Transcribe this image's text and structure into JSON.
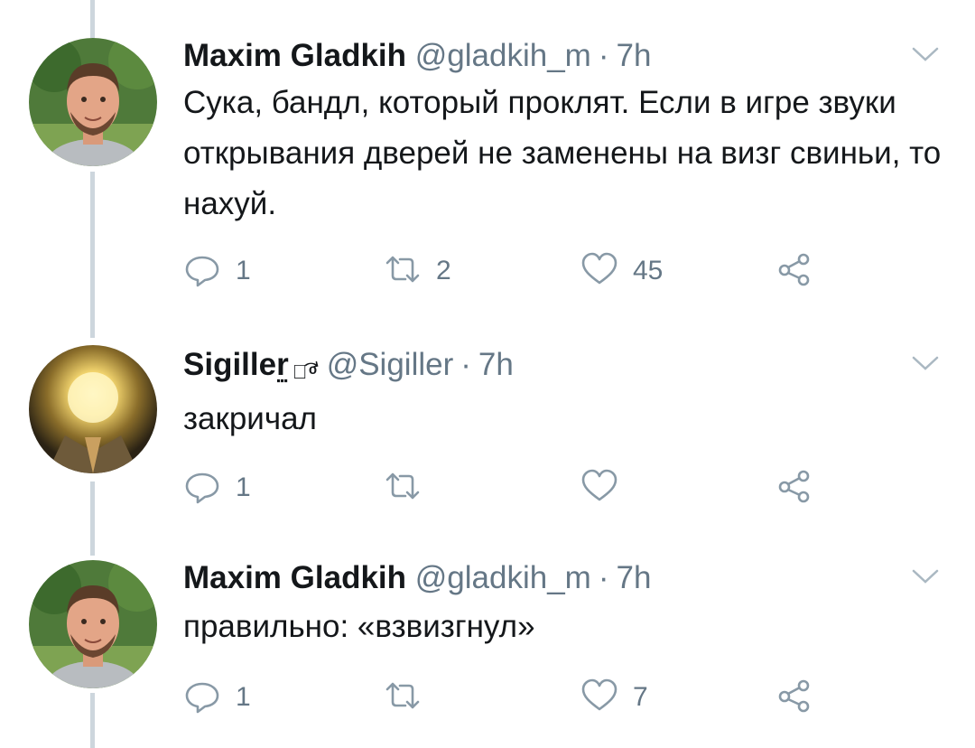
{
  "colors": {
    "text": "#14171a",
    "secondary": "#657786",
    "thread_line": "#cdd6dd",
    "icon": "#8899a6"
  },
  "tweets": [
    {
      "name": "Maxim Gladkih",
      "handle": "@gladkih_m",
      "separator": "·",
      "time": "7h",
      "text": "Сука, бандл, который проклят. Если в игре звуки открывания дверей не заменены на визг свиньи, то нахуй.",
      "avatar": "person-photo",
      "actions": {
        "reply_count": "1",
        "retweet_count": "2",
        "like_count": "45"
      }
    },
    {
      "name": "Sigiller",
      "name_decoration": "⃨ ᷓ ͦ ⃕",
      "handle": "@Sigiller",
      "separator": "·",
      "time": "7h",
      "text": "закричал",
      "avatar": "glowing-head-image",
      "actions": {
        "reply_count": "1",
        "retweet_count": "",
        "like_count": ""
      }
    },
    {
      "name": "Maxim Gladkih",
      "handle": "@gladkih_m",
      "separator": "·",
      "time": "7h",
      "text": "правильно: «взвизгнул»",
      "avatar": "person-photo",
      "actions": {
        "reply_count": "1",
        "retweet_count": "",
        "like_count": "7"
      }
    }
  ]
}
